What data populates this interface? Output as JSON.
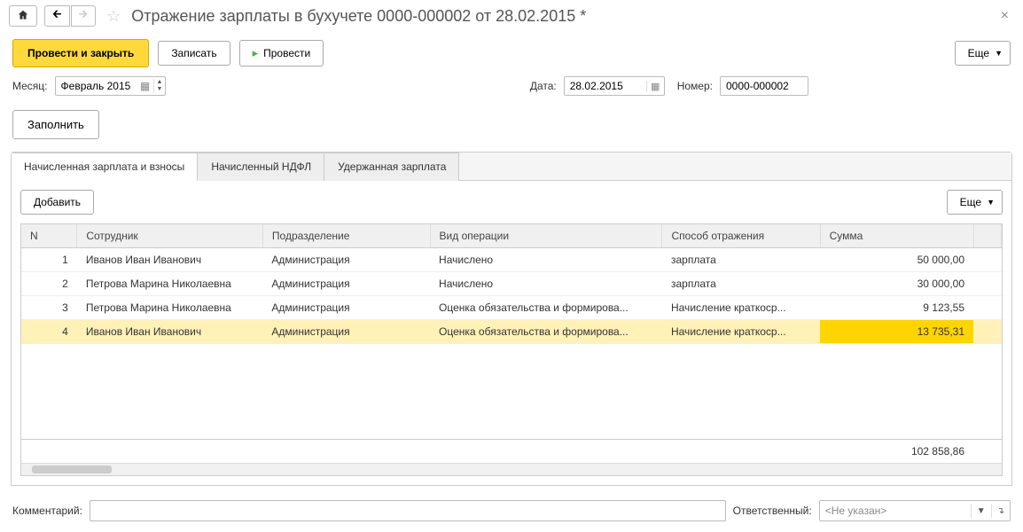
{
  "title": "Отражение зарплаты в бухучете 0000-000002 от 28.02.2015 *",
  "toolbar": {
    "post_and_close": "Провести и закрыть",
    "save": "Записать",
    "post": "Провести",
    "more": "Еще"
  },
  "fields": {
    "month_label": "Месяц:",
    "month_value": "Февраль 2015",
    "date_label": "Дата:",
    "date_value": "28.02.2015",
    "number_label": "Номер:",
    "number_value": "0000-000002"
  },
  "fill_button": "Заполнить",
  "tabs": {
    "accrued": "Начисленная зарплата и взносы",
    "ndfl": "Начисленный НДФЛ",
    "withheld": "Удержанная зарплата"
  },
  "table_toolbar": {
    "add": "Добавить",
    "more": "Еще"
  },
  "columns": {
    "n": "N",
    "employee": "Сотрудник",
    "department": "Подразделение",
    "operation": "Вид операции",
    "method": "Способ отражения",
    "sum": "Сумма"
  },
  "rows": [
    {
      "n": "1",
      "employee": "Иванов Иван Иванович",
      "department": "Администрация",
      "operation": "Начислено",
      "method": "зарплата",
      "sum": "50 000,00"
    },
    {
      "n": "2",
      "employee": "Петрова Марина Николаевна",
      "department": "Администрация",
      "operation": "Начислено",
      "method": "зарплата",
      "sum": "30 000,00"
    },
    {
      "n": "3",
      "employee": "Петрова Марина Николаевна",
      "department": "Администрация",
      "operation": "Оценка обязательства и формирова...",
      "method": "Начисление краткоср...",
      "sum": "9 123,55"
    },
    {
      "n": "4",
      "employee": "Иванов Иван Иванович",
      "department": "Администрация",
      "operation": "Оценка обязательства и формирова...",
      "method": "Начисление краткоср...",
      "sum": "13 735,31"
    }
  ],
  "total_sum": "102 858,86",
  "footer": {
    "comment_label": "Комментарий:",
    "responsible_label": "Ответственный:",
    "responsible_value": "<Не указан>"
  }
}
